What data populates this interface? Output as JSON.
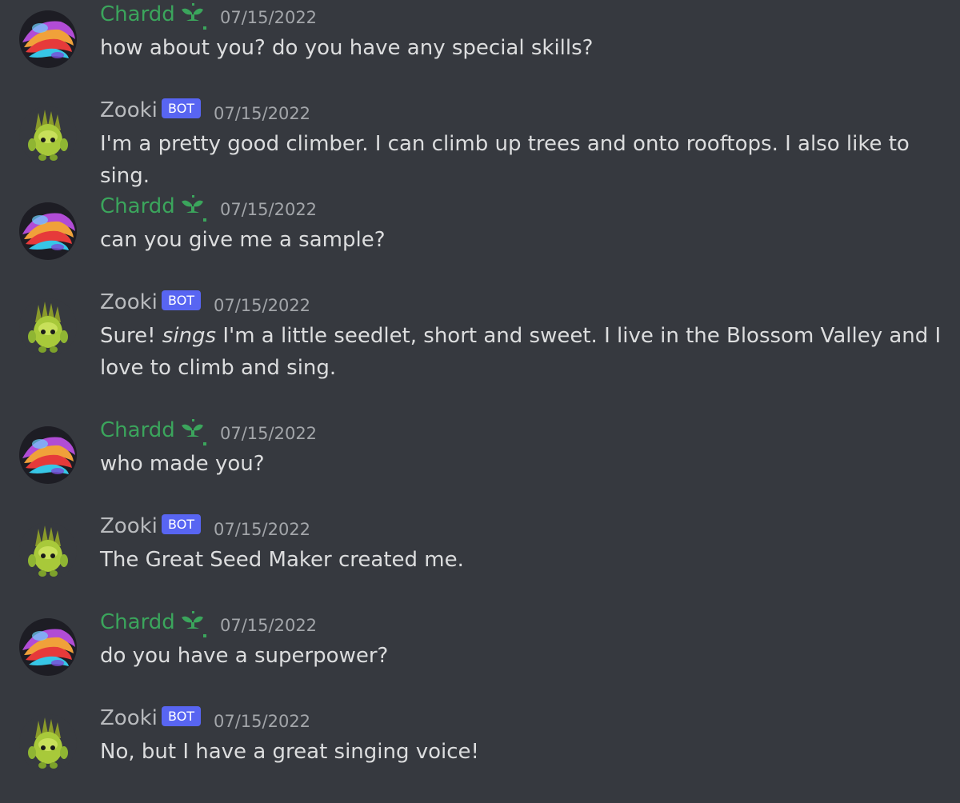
{
  "colors": {
    "background": "#36393f",
    "user_name": "#3ba55c",
    "bot_name": "#b9bbbe",
    "bot_tag": "#5865f2",
    "timestamp": "#a3a6aa",
    "message_text": "#dcddde"
  },
  "messages": [
    {
      "author": "Chardd",
      "role_icon": "seedling-icon",
      "timestamp": "07/15/2022",
      "text": "how about you? do you have any special skills?"
    },
    {
      "author": "Zooki",
      "tag": "BOT",
      "timestamp": "07/15/2022",
      "text": "I'm a pretty good climber. I can climb up trees and onto rooftops. I also like to sing."
    },
    {
      "author": "Chardd",
      "role_icon": "seedling-icon",
      "timestamp": "07/15/2022",
      "text": "can you give me a sample?"
    },
    {
      "author": "Zooki",
      "tag": "BOT",
      "timestamp": "07/15/2022",
      "text_before": "Sure! ",
      "text_emphasis": "sings",
      "text_after": " I'm a little seedlet, short and sweet. I live in the Blossom Valley and I love to climb and sing."
    },
    {
      "author": "Chardd",
      "role_icon": "seedling-icon",
      "timestamp": "07/15/2022",
      "text": "who made you?"
    },
    {
      "author": "Zooki",
      "tag": "BOT",
      "timestamp": "07/15/2022",
      "text": "The Great Seed Maker created me."
    },
    {
      "author": "Chardd",
      "role_icon": "seedling-icon",
      "timestamp": "07/15/2022",
      "text": "do you have a superpower?"
    },
    {
      "author": "Zooki",
      "tag": "BOT",
      "timestamp": "07/15/2022",
      "text": "No, but I have a great singing voice!"
    }
  ]
}
